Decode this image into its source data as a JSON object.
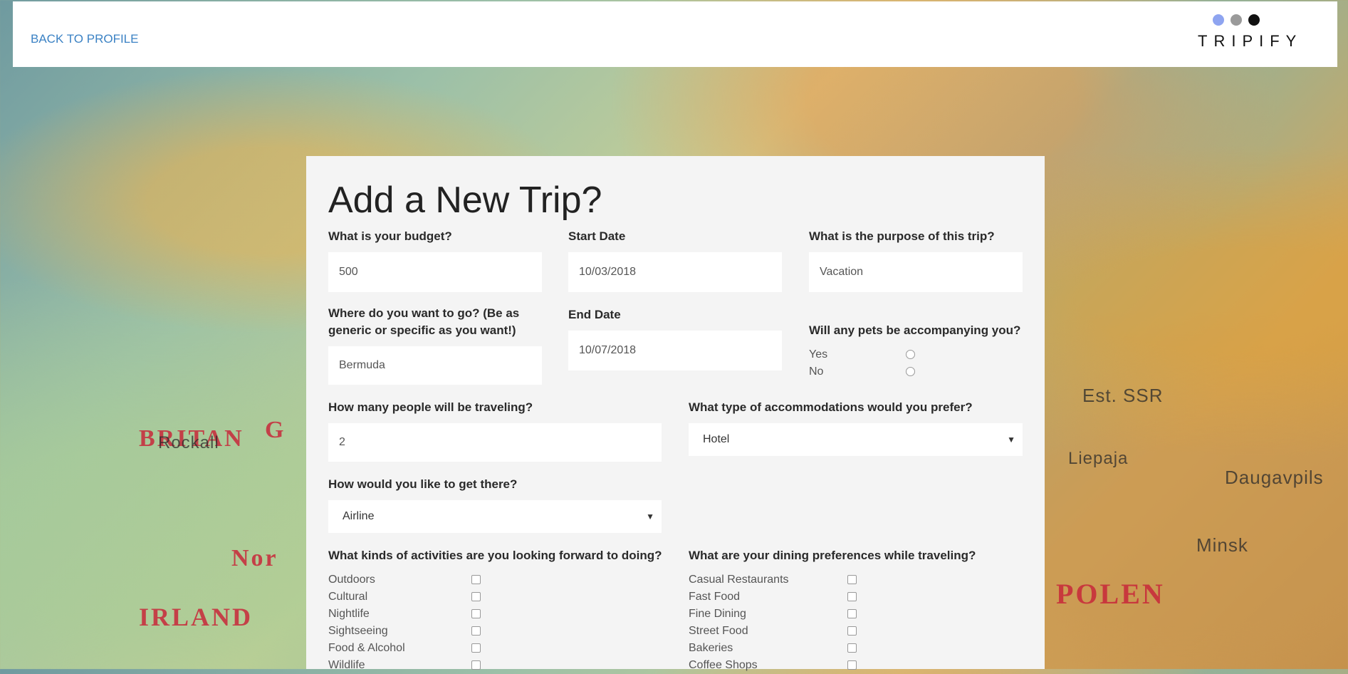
{
  "nav": {
    "back_label": "BACK TO PROFILE"
  },
  "logo": {
    "text": "TRIPIFY",
    "dot_colors": [
      "#8ea4f0",
      "#9a9a9a",
      "#111111"
    ]
  },
  "form": {
    "title": "Add a New Trip?",
    "budget": {
      "label": "What is your budget?",
      "value": "500"
    },
    "start_date": {
      "label": "Start Date",
      "value": "10/03/2018"
    },
    "purpose": {
      "label": "What is the purpose of this trip?",
      "value": "Vacation"
    },
    "destination": {
      "label": "Where do you want to go? (Be as generic or specific as you want!)",
      "value": "Bermuda"
    },
    "end_date": {
      "label": "End Date",
      "value": "10/07/2018"
    },
    "pets": {
      "label": "Will any pets be accompanying you?",
      "options": [
        "Yes",
        "No"
      ]
    },
    "travelers": {
      "label": "How many people will be traveling?",
      "value": "2"
    },
    "accommodations": {
      "label": "What type of accommodations would you prefer?",
      "value": "Hotel"
    },
    "transport": {
      "label": "How would you like to get there?",
      "value": "Airline"
    },
    "activities": {
      "label": "What kinds of activities are you looking forward to doing?",
      "options": [
        "Outdoors",
        "Cultural",
        "Nightlife",
        "Sightseeing",
        "Food & Alcohol",
        "Wildlife"
      ]
    },
    "dining": {
      "label": "What are your dining preferences while traveling?",
      "options": [
        "Casual Restaurants",
        "Fast Food",
        "Fine Dining",
        "Street Food",
        "Bakeries",
        "Coffee Shops"
      ]
    }
  }
}
